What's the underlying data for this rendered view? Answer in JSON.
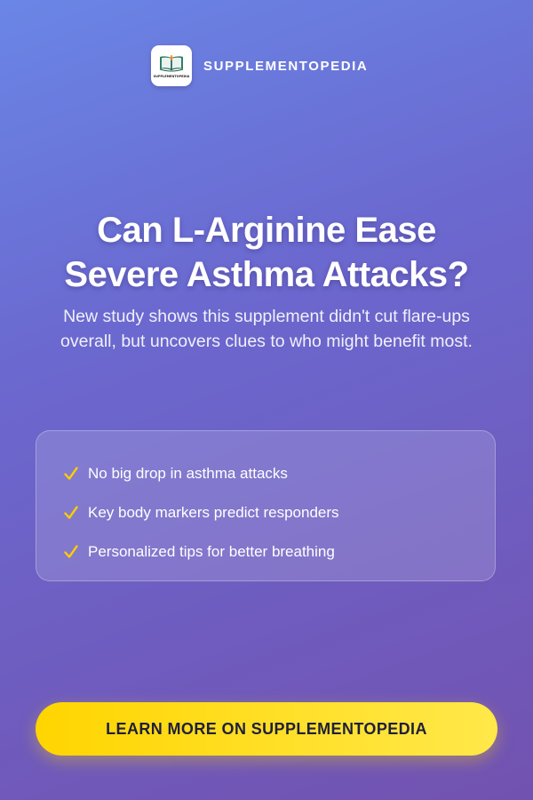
{
  "brand": {
    "logo_text": "SUPPLEMENTOPEDIA",
    "name": "SUPPLEMENTOPEDIA"
  },
  "headline": {
    "line1": "Can L-Arginine Ease",
    "line2": "Severe Asthma Attacks?"
  },
  "subhead": "New study shows this supplement didn't cut flare-ups overall, but uncovers clues to who might benefit most.",
  "benefits": [
    {
      "icon": "check-icon",
      "text": "No big drop in asthma attacks"
    },
    {
      "icon": "check-icon",
      "text": "Key body markers predict responders"
    },
    {
      "icon": "check-icon",
      "text": "Personalized tips for better breathing"
    }
  ],
  "cta": {
    "label": "LEARN MORE ON SUPPLEMENTOPEDIA"
  },
  "colors": {
    "background_top": "#6a86e6",
    "background_bottom": "#7252b0",
    "check": "#ffcc00",
    "cta": "#ffd500",
    "cta_text": "#1f1f3a"
  }
}
